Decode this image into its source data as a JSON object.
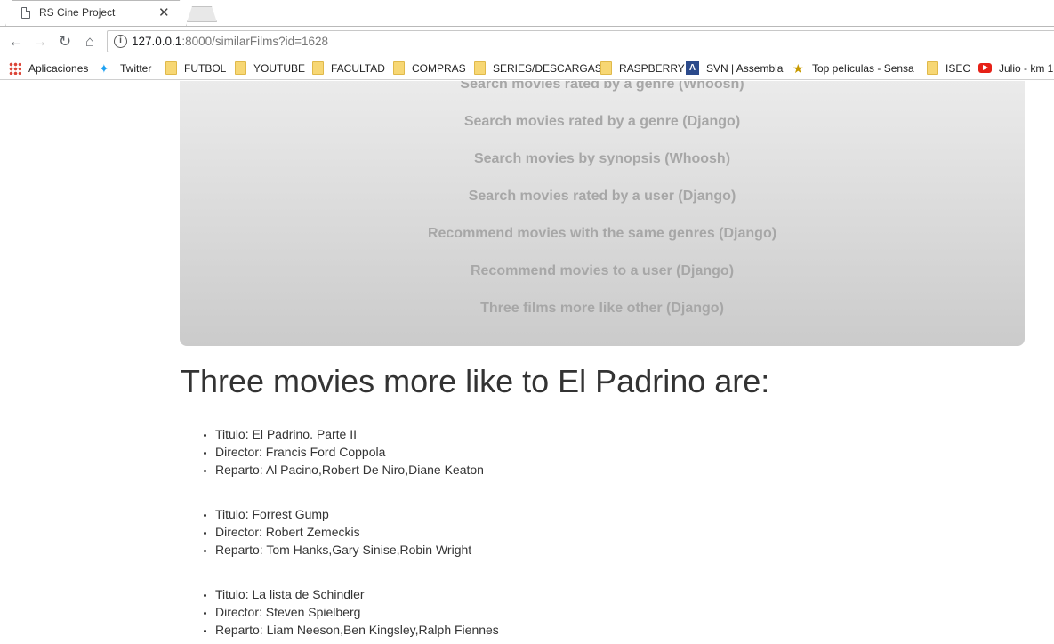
{
  "browser": {
    "tab_title": "RS Cine Project",
    "tab_close": "✕",
    "url_host": "127.0.0.1",
    "url_rest": ":8000/similarFilms?id=1628",
    "bookmarks": [
      {
        "label": "Aplicaciones",
        "icon": "apps-icon"
      },
      {
        "label": "Twitter",
        "icon": "twitter-icon"
      },
      {
        "label": "FUTBOL",
        "icon": "folder-icon"
      },
      {
        "label": "YOUTUBE",
        "icon": "folder-icon"
      },
      {
        "label": "FACULTAD",
        "icon": "folder-icon"
      },
      {
        "label": "COMPRAS",
        "icon": "folder-icon"
      },
      {
        "label": "SERIES/DESCARGAS",
        "icon": "folder-icon"
      },
      {
        "label": "RASPBERRY",
        "icon": "folder-icon"
      },
      {
        "label": "SVN | Assembla",
        "icon": "svn-icon"
      },
      {
        "label": "Top películas - Sensa",
        "icon": "star-icon"
      },
      {
        "label": "ISEC",
        "icon": "folder-icon"
      },
      {
        "label": "Julio - km 1",
        "icon": "youtube-icon"
      }
    ]
  },
  "menu": {
    "items": [
      "Search movies rated by a genre (Whoosh)",
      "Search movies rated by a genre (Django)",
      "Search movies by synopsis (Whoosh)",
      "Search movies rated by a user (Django)",
      "Recommend movies with the same genres (Django)",
      "Recommend movies to a user (Django)",
      "Three films more like other (Django)"
    ]
  },
  "page": {
    "heading": "Three movies more like to El Padrino are:",
    "films": [
      {
        "titulo": "Titulo: El Padrino. Parte II",
        "director": "Director: Francis Ford Coppola",
        "reparto": "Reparto: Al Pacino,Robert De Niro,Diane Keaton"
      },
      {
        "titulo": "Titulo: Forrest Gump",
        "director": "Director: Robert Zemeckis",
        "reparto": "Reparto: Tom Hanks,Gary Sinise,Robin Wright"
      },
      {
        "titulo": "Titulo: La lista de Schindler",
        "director": "Director: Steven Spielberg",
        "reparto": "Reparto: Liam Neeson,Ben Kingsley,Ralph Fiennes"
      }
    ]
  }
}
